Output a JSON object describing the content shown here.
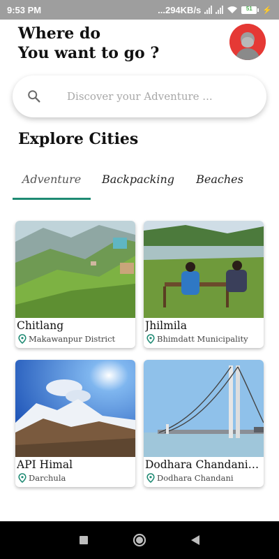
{
  "status_bar": {
    "time": "9:53 PM",
    "network_speed": "...294KB/s",
    "battery_level": "51"
  },
  "header": {
    "title_line1": "Where do",
    "title_line2": "You want to go ?"
  },
  "search": {
    "placeholder": "Discover your Adventure ..."
  },
  "section_title": "Explore Cities",
  "tabs": [
    {
      "label": "Adventure",
      "active": true
    },
    {
      "label": "Backpacking",
      "active": false
    },
    {
      "label": "Beaches",
      "active": false
    }
  ],
  "cards": [
    {
      "title": "Chitlang",
      "location": "Makawanpur District"
    },
    {
      "title": "Jhilmila",
      "location": "Bhimdatt Municipality"
    },
    {
      "title": "API Himal",
      "location": "Darchula"
    },
    {
      "title": "Dodhara Chandani ...",
      "location": "Dodhara Chandani"
    }
  ],
  "colors": {
    "accent": "#1e8a73",
    "avatar_bg": "#e53935",
    "status_bar": "#9e9e9e"
  },
  "icons": {
    "search": "search-icon",
    "location": "location-pin-icon",
    "nav_recent": "square-icon",
    "nav_home": "circle-icon",
    "nav_back": "triangle-back-icon"
  }
}
